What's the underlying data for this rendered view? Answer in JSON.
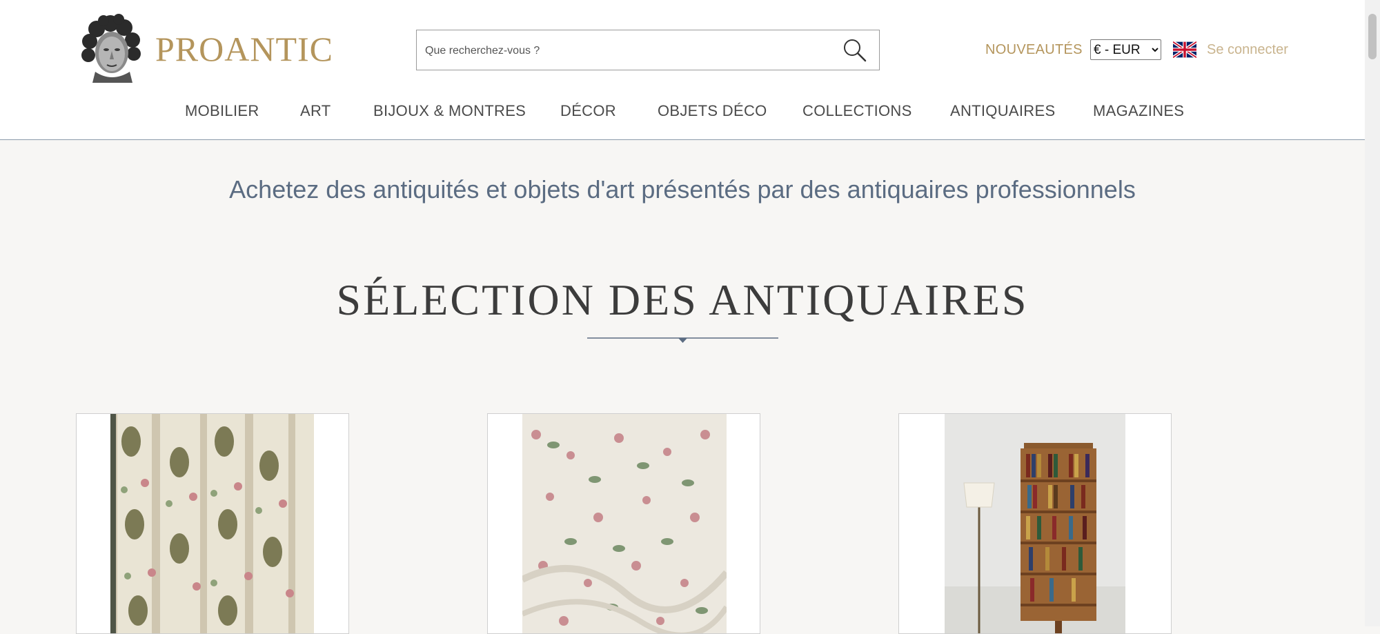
{
  "brand": {
    "name": "PROANTIC"
  },
  "search": {
    "placeholder": "Que recherchez-vous ?"
  },
  "header": {
    "nouveautes": "NOUVEAUTÉS",
    "currency_selected": "€ - EUR",
    "connect": "Se connecter"
  },
  "nav": {
    "items": [
      {
        "label": "MOBILIER"
      },
      {
        "label": "ART"
      },
      {
        "label": "BIJOUX & MONTRES"
      },
      {
        "label": "DÉCOR"
      },
      {
        "label": "OBJETS DÉCO"
      },
      {
        "label": "COLLECTIONS"
      },
      {
        "label": "ANTIQUAIRES"
      },
      {
        "label": "MAGAZINES"
      }
    ]
  },
  "main": {
    "tagline": "Achetez des antiquités et objets d'art présentés par des antiquaires professionnels",
    "section_title": "SÉLECTION DES ANTIQUAIRES"
  },
  "colors": {
    "brand_gold": "#b4955c",
    "link_gold_light": "#c9b48e",
    "tagline_blue": "#5b6c82",
    "background": "#f7f6f4"
  },
  "icons": {
    "logo": "classical-bust-icon",
    "search": "magnifier-icon",
    "language": "uk-flag-icon"
  }
}
